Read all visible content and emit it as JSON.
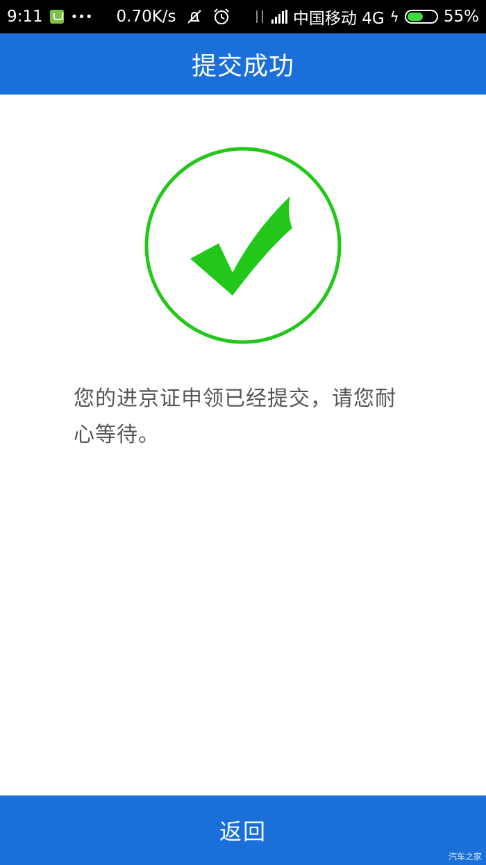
{
  "status_bar": {
    "time": "9:11",
    "more": "•••",
    "speed": "0.70K/s",
    "carrier": "中国移动 4G",
    "battery": "55%",
    "battery_level": 0.55
  },
  "header": {
    "title": "提交成功"
  },
  "main": {
    "message": "您的进京证申领已经提交，请您耐心等待。"
  },
  "footer": {
    "back_label": "返回"
  },
  "watermark": "汽车之家",
  "colors": {
    "accent_blue": "#1a70d8",
    "success_green": "#22c71a",
    "text_gray": "#555555"
  },
  "icons": [
    "app-notification-icon",
    "mute-icon",
    "alarm-icon",
    "data-arrows-icon",
    "signal-icon",
    "charging-icon",
    "battery-icon",
    "success-check-icon"
  ]
}
